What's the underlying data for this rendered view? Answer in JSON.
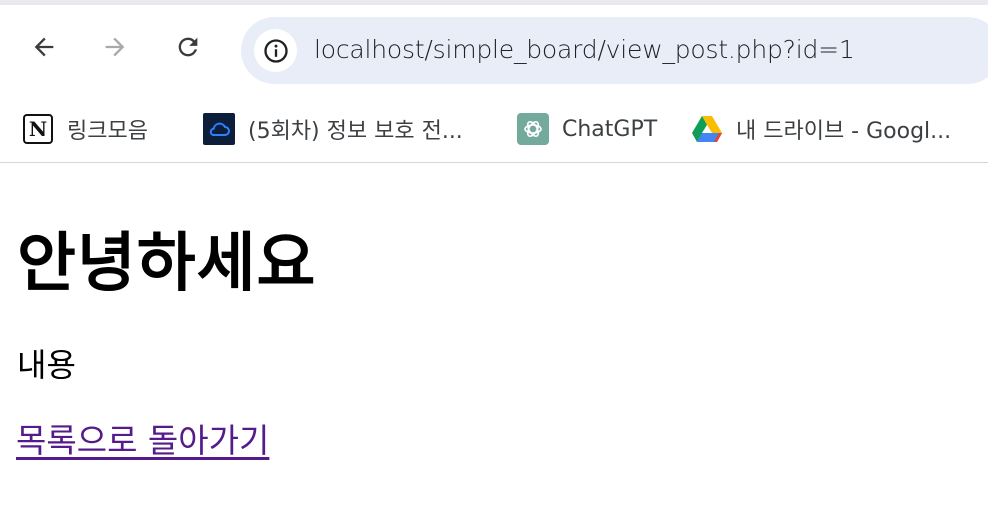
{
  "browser": {
    "url": "localhost/simple_board/view_post.php?id=1",
    "nav_icons": [
      "back-arrow-icon",
      "forward-arrow-icon",
      "reload-icon",
      "site-info-icon"
    ]
  },
  "bookmarks": [
    {
      "label": "링크모음",
      "icon": "notion-icon"
    },
    {
      "label": "(5회차) 정보 보호 전...",
      "icon": "cloud-icon"
    },
    {
      "label": "ChatGPT",
      "icon": "chatgpt-icon"
    },
    {
      "label": "내 드라이브 - Googl...",
      "icon": "google-drive-icon"
    }
  ],
  "page": {
    "title": "안녕하세요",
    "content": "내용",
    "back_link": "목록으로 돌아가기"
  },
  "colors": {
    "link_visited": "#551a8b",
    "omnibox_bg": "#e9edf7",
    "text": "#000000"
  }
}
